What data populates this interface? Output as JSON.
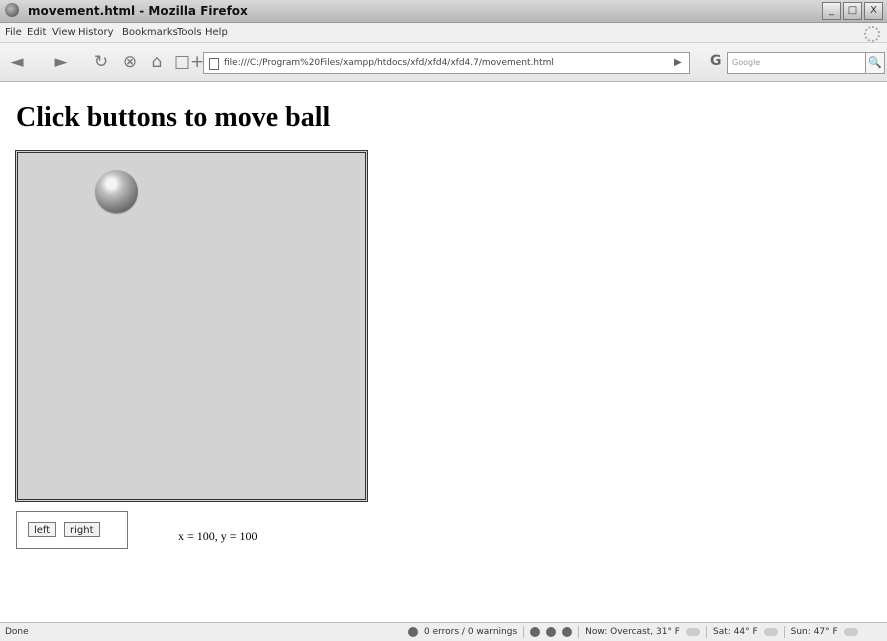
{
  "window": {
    "title": "movement.html - Mozilla Firefox",
    "controls": [
      "_",
      "□",
      "X"
    ]
  },
  "menu": [
    "File",
    "Edit",
    "View",
    "History",
    "Bookmarks",
    "Tools",
    "Help"
  ],
  "nav": {
    "back": "◄",
    "forward": "►",
    "reload": "↻",
    "stop": "⊗",
    "home": "⌂",
    "new_tab": "□+",
    "url": "file:///C:/Program%20Files/xampp/htdocs/xfd/xfd4/xfd4.7/movement.html",
    "go": "▶",
    "search_engine": "G",
    "search_placeholder": "Google",
    "search_icon": "🔍"
  },
  "page": {
    "heading": "Click buttons to move ball",
    "buttons": {
      "left": "left",
      "right": "right"
    },
    "coords": "x = 100, y = 100"
  },
  "status": {
    "left": "Done",
    "errors": "0 errors / 0 warnings",
    "weather_now": "Now: Overcast, 31° F",
    "weather_sat": "Sat: 44° F",
    "weather_sun": "Sun: 47° F"
  },
  "colors": {
    "stage_bg": "#d3d3d3",
    "stage_border": "#333333",
    "ball": "#7f7f7f"
  }
}
